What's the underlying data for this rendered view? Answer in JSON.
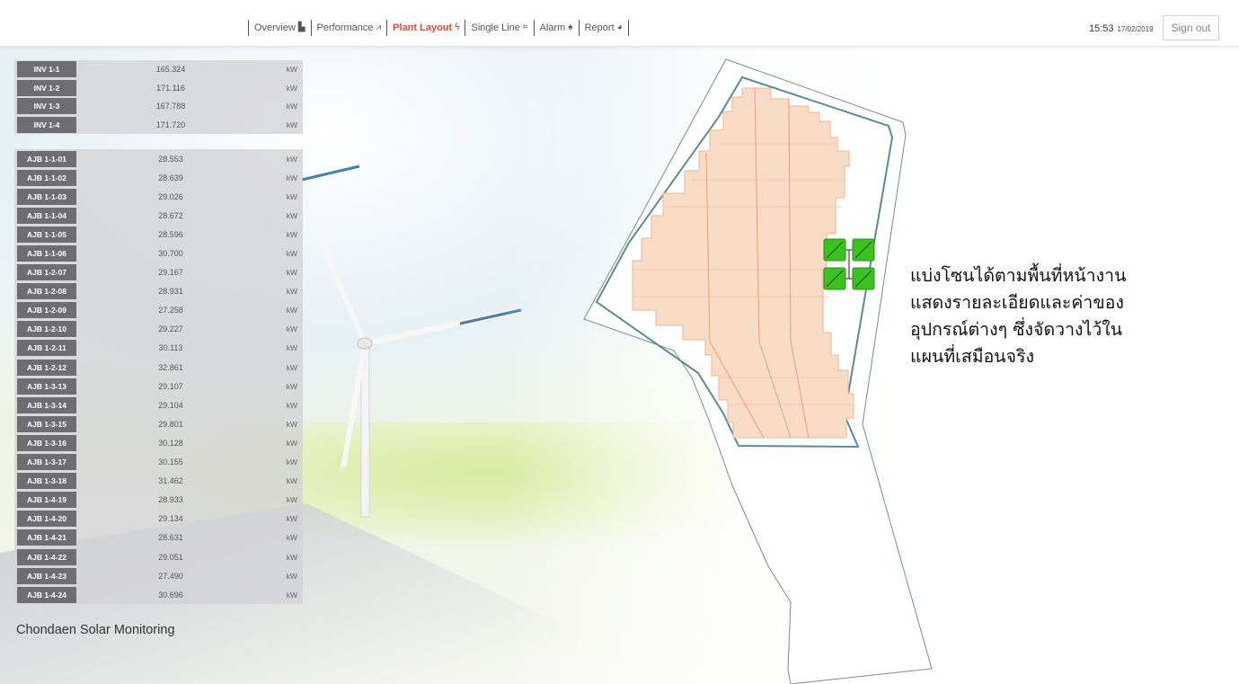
{
  "nav": {
    "items": [
      {
        "label": "Overview",
        "icon": "area-chart-icon",
        "glyph": "▙",
        "active": false
      },
      {
        "label": "Performance",
        "icon": "line-chart-icon",
        "glyph": "⩘",
        "active": false
      },
      {
        "label": "Plant Layout",
        "icon": "bolt-icon",
        "glyph": "ϟ",
        "active": true
      },
      {
        "label": "Single Line",
        "icon": "diagram-icon",
        "glyph": "⌗",
        "active": false
      },
      {
        "label": "Alarm",
        "icon": "bell-icon",
        "glyph": "♠",
        "active": false
      },
      {
        "label": "Report",
        "icon": "globe-icon",
        "glyph": "◕",
        "active": false
      }
    ],
    "active_color": "#e84b2a"
  },
  "clock": {
    "time": "15:53",
    "date": "17/02/2019"
  },
  "signout_label": "Sign out",
  "inverters": [
    {
      "label": "INV 1-1",
      "value": "165.324",
      "unit": "kW"
    },
    {
      "label": "INV 1-2",
      "value": "171.116",
      "unit": "kW"
    },
    {
      "label": "INV 1-3",
      "value": "167.788",
      "unit": "kW"
    },
    {
      "label": "INV 1-4",
      "value": "171.720",
      "unit": "kW"
    }
  ],
  "ajbs": [
    {
      "label": "AJB 1-1-01",
      "value": "28.553",
      "unit": "kW"
    },
    {
      "label": "AJB 1-1-02",
      "value": "28.639",
      "unit": "kW"
    },
    {
      "label": "AJB 1-1-03",
      "value": "29.026",
      "unit": "kW"
    },
    {
      "label": "AJB 1-1-04",
      "value": "28.672",
      "unit": "kW"
    },
    {
      "label": "AJB 1-1-05",
      "value": "28.596",
      "unit": "kW"
    },
    {
      "label": "AJB 1-1-06",
      "value": "30.700",
      "unit": "kW"
    },
    {
      "label": "AJB 1-2-07",
      "value": "29.167",
      "unit": "kW"
    },
    {
      "label": "AJB 1-2-08",
      "value": "28.931",
      "unit": "kW"
    },
    {
      "label": "AJB 1-2-09",
      "value": "27.258",
      "unit": "kW"
    },
    {
      "label": "AJB 1-2-10",
      "value": "29.227",
      "unit": "kW"
    },
    {
      "label": "AJB 1-2-11",
      "value": "30.113",
      "unit": "kW"
    },
    {
      "label": "AJB 1-2-12",
      "value": "32.861",
      "unit": "kW"
    },
    {
      "label": "AJB 1-3-13",
      "value": "29.107",
      "unit": "kW"
    },
    {
      "label": "AJB 1-3-14",
      "value": "29.104",
      "unit": "kW"
    },
    {
      "label": "AJB 1-3-15",
      "value": "29.801",
      "unit": "kW"
    },
    {
      "label": "AJB 1-3-16",
      "value": "30.128",
      "unit": "kW"
    },
    {
      "label": "AJB 1-3-17",
      "value": "30.155",
      "unit": "kW"
    },
    {
      "label": "AJB 1-3-18",
      "value": "31.462",
      "unit": "kW"
    },
    {
      "label": "AJB 1-4-19",
      "value": "28.933",
      "unit": "kW"
    },
    {
      "label": "AJB 1-4-20",
      "value": "29.134",
      "unit": "kW"
    },
    {
      "label": "AJB 1-4-21",
      "value": "28.631",
      "unit": "kW"
    },
    {
      "label": "AJB 1-4-22",
      "value": "29.051",
      "unit": "kW"
    },
    {
      "label": "AJB 1-4-23",
      "value": "27.490",
      "unit": "kW"
    },
    {
      "label": "AJB 1-4-24",
      "value": "30.696",
      "unit": "kW"
    }
  ],
  "brand": "Chondaen Solar Monitoring",
  "caption_lines": [
    "แบ่งโซนได้ตามพื้นที่หน้างาน",
    "แสดงรายละเอียดและค่าของ",
    "อุปกรณ์ต่างๆ ซึ่งจัดวางไว้ใน",
    "แผนที่เสมือนจริง"
  ],
  "colors": {
    "panel_fill": "#f9dcc6",
    "panel_line": "#ef9a6e",
    "inverter_green": "#3cc21e",
    "boundary": "#5a8a96",
    "label_bg": "#6e6e72"
  }
}
